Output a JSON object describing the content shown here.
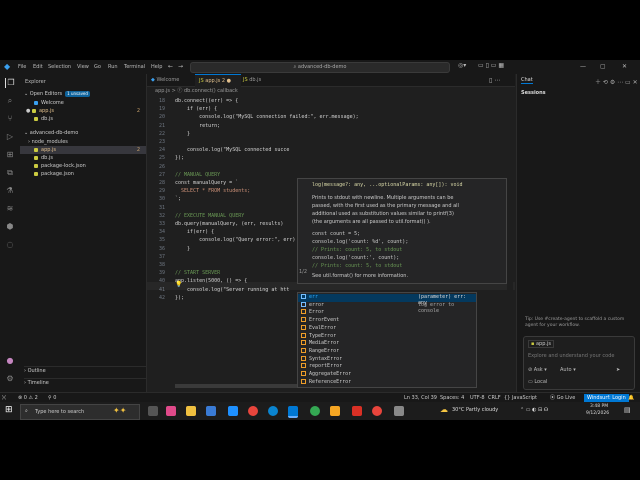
{
  "titlebar": {
    "menu": [
      "File",
      "Edit",
      "Selection",
      "View",
      "Go",
      "Run",
      "Terminal",
      "Help"
    ],
    "search": "advanced-db-demo"
  },
  "sidebar": {
    "title": "Explorer",
    "open_editors": "Open Editors",
    "unsaved": "1 unsaved",
    "open_files": [
      {
        "name": "Welcome",
        "badge": ""
      },
      {
        "name": "app.js",
        "badge": "2"
      },
      {
        "name": "db.js",
        "badge": ""
      }
    ],
    "project": "advanced-db-demo",
    "tree": [
      {
        "name": "node_modules",
        "badge": ""
      },
      {
        "name": "app.js",
        "badge": "2"
      },
      {
        "name": "db.js",
        "badge": ""
      },
      {
        "name": "package-lock.json",
        "badge": ""
      },
      {
        "name": "package.json",
        "badge": ""
      }
    ],
    "outline": "Outline",
    "timeline": "Timeline"
  },
  "tabs": [
    {
      "label": "Welcome"
    },
    {
      "label": "app.js 2"
    },
    {
      "label": "db.js"
    }
  ],
  "breadcrumb": "app.js  >  ⓕ db.connect() callback",
  "code_lines": [
    {
      "n": "18",
      "t": "db.connect((err) => {"
    },
    {
      "n": "19",
      "t": "    if (err) {"
    },
    {
      "n": "20",
      "t": "        console.log(\"MySQL connection failed:\", err.message);"
    },
    {
      "n": "21",
      "t": "        return;"
    },
    {
      "n": "22",
      "t": "    }"
    },
    {
      "n": "23",
      "t": ""
    },
    {
      "n": "24",
      "t": "    console.log(\"MySQL connected succe"
    },
    {
      "n": "25",
      "t": "});"
    },
    {
      "n": "26",
      "t": ""
    },
    {
      "n": "27",
      "t": "// MANUAL QUERY"
    },
    {
      "n": "28",
      "t": "const manualQuery = `"
    },
    {
      "n": "29",
      "t": "  SELECT * FROM students;"
    },
    {
      "n": "30",
      "t": "`;"
    },
    {
      "n": "31",
      "t": ""
    },
    {
      "n": "32",
      "t": "// EXECUTE MANUAL QUERY"
    },
    {
      "n": "33",
      "t": "db.query(manualQuery, (err, results)"
    },
    {
      "n": "34",
      "t": "    if(err) {"
    },
    {
      "n": "35",
      "t": "        console.log(\"Query error:\", err)"
    },
    {
      "n": "36",
      "t": "    }"
    },
    {
      "n": "37",
      "t": ""
    },
    {
      "n": "38",
      "t": ""
    },
    {
      "n": "39",
      "t": "// START SERVER"
    },
    {
      "n": "40",
      "t": "app.listen(5000, () => {"
    },
    {
      "n": "41",
      "t": "    console.log(\"Server running at htt"
    },
    {
      "n": "42",
      "t": "});"
    }
  ],
  "hover": {
    "signature": "log(message?: any, ...optionalParams: any[]): void",
    "desc1": "Prints to  stdout  with newline. Multiple arguments can be",
    "desc2": "passed, with the first used as the primary message and all",
    "desc3": "additional used as substitution values similar to  printf(3)",
    "desc4": "(the arguments are all passed to  util.format() ).",
    "ex1": "const count = 5;",
    "ex2": "console.log('count: %d', count);",
    "ex3": "// Prints: count: 5, to stdout",
    "ex4": "console.log('count:', count);",
    "ex5": "// Prints: count: 5, to stdout",
    "see": "See  util.format()  for more information.",
    "page": "1/2"
  },
  "suggest": {
    "items": [
      "err",
      "error",
      "Error",
      "ErrorEvent",
      "EvalError",
      "TypeError",
      "MediaError",
      "RangeError",
      "SyntaxError",
      "reportError",
      "AggregateError",
      "ReferenceError"
    ],
    "detail_type": "(parameter) err: any",
    "detail_right": "log error to console"
  },
  "chat": {
    "title": "Chat",
    "sessions": "Sessions",
    "tip": "Tip: Use #create-agent to scaffold a custom agent for your workflow.",
    "context_file": "app.js",
    "input_placeholder": "Explore and understand your code",
    "mode": "Ask",
    "model": "Auto",
    "local": "Local"
  },
  "status": {
    "left": "⊗ 0 ⚠ 2",
    "zero": "⚲ 0",
    "position": "Ln 33, Col 39",
    "spaces": "Spaces: 4",
    "encoding": "UTF-8",
    "eol": "CRLF",
    "language": "{} JavaScript",
    "golive": "Go Live",
    "windsurf": "Windsurf: Login"
  },
  "taskbar": {
    "search_placeholder": "Type here to search",
    "weather": "30°C  Partly cloudy",
    "time": "3:48 PM",
    "date": "9/12/2026"
  },
  "colors": {
    "accent": "#0078d4",
    "editor_bg": "#1f1f1f",
    "sidebar_bg": "#181818"
  }
}
